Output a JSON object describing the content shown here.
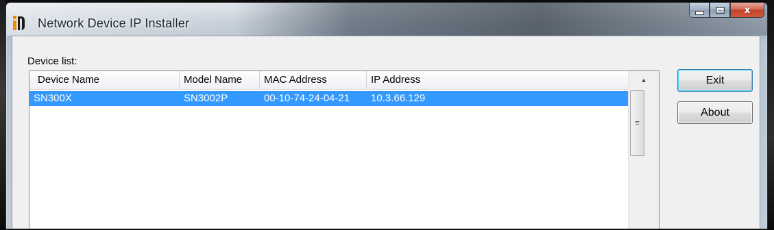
{
  "window": {
    "title": "Network Device IP Installer",
    "close_glyph": "x"
  },
  "device_list": {
    "label": "Device list:",
    "columns": [
      "Device Name",
      "Model Name",
      "MAC Address",
      "IP Address"
    ],
    "rows": [
      {
        "device_name": "SN300X",
        "model_name": "SN3002P",
        "mac_address": "00-10-74-24-04-21",
        "ip_address": "10.3.66.129",
        "selected": true
      }
    ]
  },
  "buttons": {
    "exit_label": "Exit",
    "about_label": "About"
  },
  "colors": {
    "selection": "#3399ff",
    "close_button": "#c0432a",
    "icon_accent": "#f08a00"
  }
}
